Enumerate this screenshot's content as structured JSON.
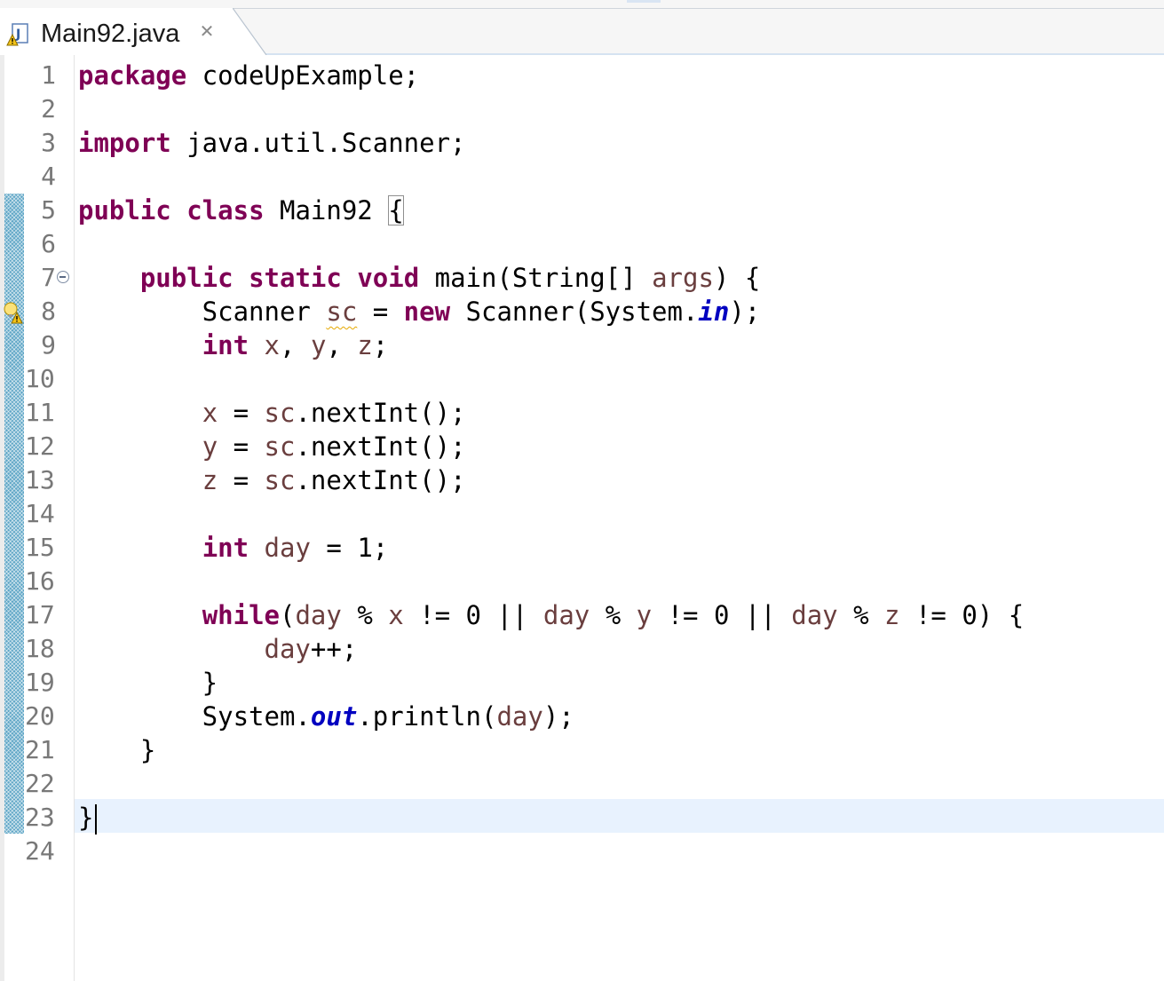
{
  "tab": {
    "title": "Main92.java",
    "close_glyph": "✕",
    "icon": "java-file-warning-icon"
  },
  "editor": {
    "lines": [
      {
        "num": "1",
        "tokens": [
          {
            "t": "package",
            "c": "kw"
          },
          {
            "t": " codeUpExample;",
            "c": "plain"
          }
        ]
      },
      {
        "num": "2",
        "tokens": []
      },
      {
        "num": "3",
        "tokens": [
          {
            "t": "import",
            "c": "kw"
          },
          {
            "t": " java.util.Scanner;",
            "c": "plain"
          }
        ]
      },
      {
        "num": "4",
        "tokens": []
      },
      {
        "num": "5",
        "tokens": [
          {
            "t": "public",
            "c": "kw"
          },
          {
            "t": " ",
            "c": "plain"
          },
          {
            "t": "class",
            "c": "kw"
          },
          {
            "t": " Main92 ",
            "c": "plain"
          },
          {
            "t": "{",
            "c": "brace-box"
          }
        ]
      },
      {
        "num": "6",
        "tokens": []
      },
      {
        "num": "7",
        "fold": true,
        "tokens": [
          {
            "t": "    ",
            "c": "plain"
          },
          {
            "t": "public",
            "c": "kw"
          },
          {
            "t": " ",
            "c": "plain"
          },
          {
            "t": "static",
            "c": "kw"
          },
          {
            "t": " ",
            "c": "plain"
          },
          {
            "t": "void",
            "c": "kw"
          },
          {
            "t": " main(String[] ",
            "c": "plain"
          },
          {
            "t": "args",
            "c": "var"
          },
          {
            "t": ") {",
            "c": "plain"
          }
        ]
      },
      {
        "num": "8",
        "warning": true,
        "tokens": [
          {
            "t": "        Scanner ",
            "c": "plain"
          },
          {
            "t": "sc",
            "c": "var squiggle"
          },
          {
            "t": " = ",
            "c": "plain"
          },
          {
            "t": "new",
            "c": "kw"
          },
          {
            "t": " Scanner(System.",
            "c": "plain"
          },
          {
            "t": "in",
            "c": "fld"
          },
          {
            "t": ");",
            "c": "plain"
          }
        ]
      },
      {
        "num": "9",
        "tokens": [
          {
            "t": "        ",
            "c": "plain"
          },
          {
            "t": "int",
            "c": "kw"
          },
          {
            "t": " ",
            "c": "plain"
          },
          {
            "t": "x",
            "c": "var"
          },
          {
            "t": ", ",
            "c": "plain"
          },
          {
            "t": "y",
            "c": "var"
          },
          {
            "t": ", ",
            "c": "plain"
          },
          {
            "t": "z",
            "c": "var"
          },
          {
            "t": ";",
            "c": "plain"
          }
        ]
      },
      {
        "num": "10",
        "tokens": []
      },
      {
        "num": "11",
        "tokens": [
          {
            "t": "        ",
            "c": "plain"
          },
          {
            "t": "x",
            "c": "var"
          },
          {
            "t": " = ",
            "c": "plain"
          },
          {
            "t": "sc",
            "c": "var"
          },
          {
            "t": ".nextInt();",
            "c": "plain"
          }
        ]
      },
      {
        "num": "12",
        "tokens": [
          {
            "t": "        ",
            "c": "plain"
          },
          {
            "t": "y",
            "c": "var"
          },
          {
            "t": " = ",
            "c": "plain"
          },
          {
            "t": "sc",
            "c": "var"
          },
          {
            "t": ".nextInt();",
            "c": "plain"
          }
        ]
      },
      {
        "num": "13",
        "tokens": [
          {
            "t": "        ",
            "c": "plain"
          },
          {
            "t": "z",
            "c": "var"
          },
          {
            "t": " = ",
            "c": "plain"
          },
          {
            "t": "sc",
            "c": "var"
          },
          {
            "t": ".nextInt();",
            "c": "plain"
          }
        ]
      },
      {
        "num": "14",
        "tokens": []
      },
      {
        "num": "15",
        "tokens": [
          {
            "t": "        ",
            "c": "plain"
          },
          {
            "t": "int",
            "c": "kw"
          },
          {
            "t": " ",
            "c": "plain"
          },
          {
            "t": "day",
            "c": "var"
          },
          {
            "t": " = 1;",
            "c": "plain"
          }
        ]
      },
      {
        "num": "16",
        "tokens": []
      },
      {
        "num": "17",
        "tokens": [
          {
            "t": "        ",
            "c": "plain"
          },
          {
            "t": "while",
            "c": "kw"
          },
          {
            "t": "(",
            "c": "plain"
          },
          {
            "t": "day",
            "c": "var"
          },
          {
            "t": " % ",
            "c": "plain"
          },
          {
            "t": "x",
            "c": "var"
          },
          {
            "t": " != 0 || ",
            "c": "plain"
          },
          {
            "t": "day",
            "c": "var"
          },
          {
            "t": " % ",
            "c": "plain"
          },
          {
            "t": "y",
            "c": "var"
          },
          {
            "t": " != 0 || ",
            "c": "plain"
          },
          {
            "t": "day",
            "c": "var"
          },
          {
            "t": " % ",
            "c": "plain"
          },
          {
            "t": "z",
            "c": "var"
          },
          {
            "t": " != 0) {",
            "c": "plain"
          }
        ]
      },
      {
        "num": "18",
        "tokens": [
          {
            "t": "            ",
            "c": "plain"
          },
          {
            "t": "day",
            "c": "var"
          },
          {
            "t": "++;",
            "c": "plain"
          }
        ]
      },
      {
        "num": "19",
        "tokens": [
          {
            "t": "        }",
            "c": "plain"
          }
        ]
      },
      {
        "num": "20",
        "tokens": [
          {
            "t": "        System.",
            "c": "plain"
          },
          {
            "t": "out",
            "c": "fld"
          },
          {
            "t": ".println(",
            "c": "plain"
          },
          {
            "t": "day",
            "c": "var"
          },
          {
            "t": ");",
            "c": "plain"
          }
        ]
      },
      {
        "num": "21",
        "tokens": [
          {
            "t": "    }",
            "c": "plain"
          }
        ]
      },
      {
        "num": "22",
        "tokens": []
      },
      {
        "num": "23",
        "current": true,
        "tokens": [
          {
            "t": "}",
            "c": "plain"
          }
        ]
      },
      {
        "num": "24",
        "tokens": []
      }
    ],
    "colors": {
      "keyword": "#7f0055",
      "variable": "#6a3e3e",
      "static_field": "#0000c0",
      "current_line": "#e8f2fe",
      "change_bar": "#5fa6c6"
    }
  }
}
